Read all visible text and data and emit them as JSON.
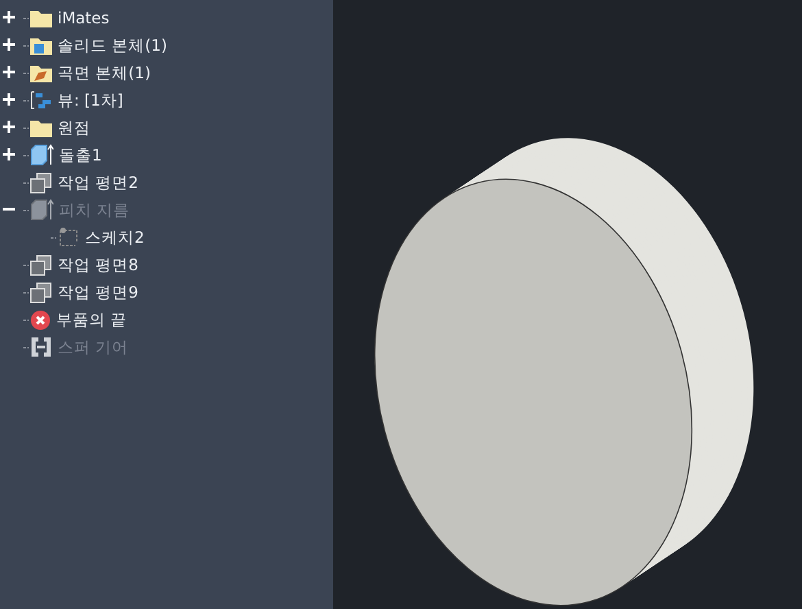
{
  "browser": {
    "items": [
      {
        "label": "iMates",
        "kind": "folder",
        "expanded": false,
        "disabled": false
      },
      {
        "label": "솔리드 본체(1)",
        "kind": "solid-folder",
        "expanded": false,
        "disabled": false
      },
      {
        "label": "곡면 본체(1)",
        "kind": "surface-folder",
        "expanded": false,
        "disabled": false
      },
      {
        "label": "뷰: [1차]",
        "kind": "view",
        "expanded": false,
        "disabled": false
      },
      {
        "label": "원점",
        "kind": "folder",
        "expanded": false,
        "disabled": false
      },
      {
        "label": "돌출1",
        "kind": "extrude",
        "expanded": false,
        "disabled": false
      },
      {
        "label": "작업 평면2",
        "kind": "plane",
        "disabled": false
      },
      {
        "label": "피치 지름",
        "kind": "extrude",
        "expanded": true,
        "disabled": true,
        "children": [
          {
            "label": "스케치2",
            "kind": "sketch",
            "disabled": false
          }
        ]
      },
      {
        "label": "작업 평면8",
        "kind": "plane",
        "disabled": false
      },
      {
        "label": "작업 평면9",
        "kind": "plane",
        "disabled": false
      },
      {
        "label": "부품의 끝",
        "kind": "end",
        "disabled": false
      },
      {
        "label": "스퍼 기어",
        "kind": "gear",
        "disabled": true
      }
    ]
  }
}
